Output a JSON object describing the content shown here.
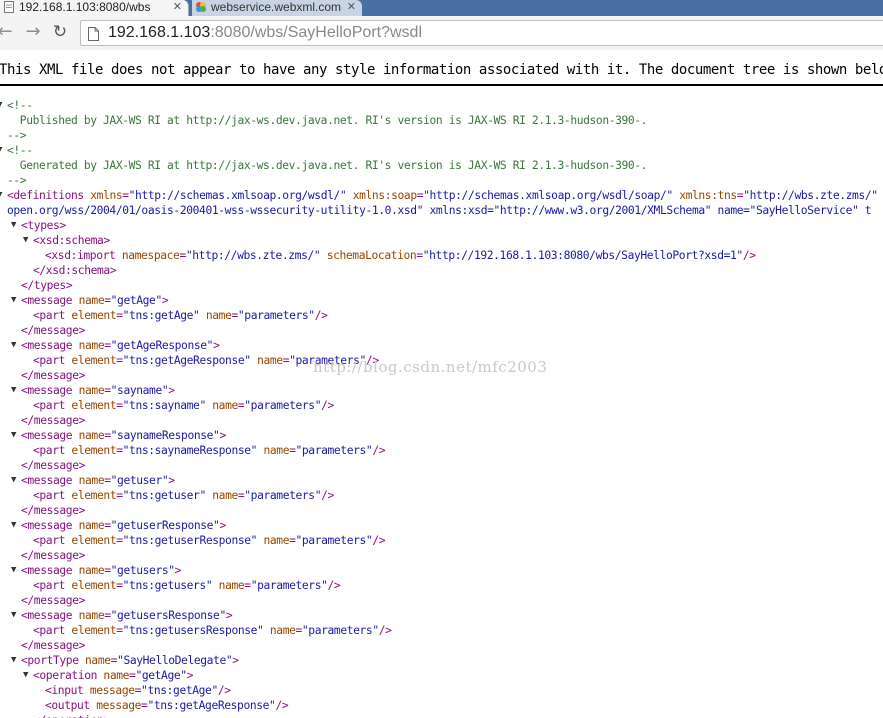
{
  "tabs": [
    {
      "title": "192.168.1.103:8080/wbs",
      "active": true,
      "icon": "page-icon"
    },
    {
      "title": "webservice.webxml.com",
      "active": false,
      "icon": "colorful-favicon"
    }
  ],
  "address": {
    "host": "192.168.1.103",
    "path": ":8080/wbs/SayHelloPort?wsdl"
  },
  "infobar_text": "This XML file does not appear to have any style information associated with it. The document tree is shown below.",
  "watermark": "http://blog.csdn.net/mfc2003",
  "xml_lines": [
    {
      "toggle": true,
      "text": "<!--",
      "cls": "c"
    },
    {
      "toggle": false,
      "text": "  Published by JAX-WS RI at http://jax-ws.dev.java.net. RI's version is JAX-WS RI 2.1.3-hudson-390-.",
      "cls": "c"
    },
    {
      "toggle": false,
      "text": "-->",
      "cls": "c"
    },
    {
      "toggle": true,
      "text": "<!--",
      "cls": "c"
    },
    {
      "toggle": false,
      "text": "  Generated by JAX-WS RI at http://jax-ws.dev.java.net. RI's version is JAX-WS RI 2.1.3-hudson-390-.",
      "cls": "c"
    },
    {
      "toggle": false,
      "text": "-->",
      "cls": "c"
    },
    {
      "toggle": true,
      "text": "<definitions xmlns=\"http://schemas.xmlsoap.org/wsdl/\" xmlns:soap=\"http://schemas.xmlsoap.org/wsdl/soap/\" xmlns:tns=\"http://wbs.zte.zms/\""
    },
    {
      "toggle": false,
      "text": "open.org/wss/2004/01/oasis-200401-wss-wssecurity-utility-1.0.xsd\" xmlns:xsd=\"http://www.w3.org/2001/XMLSchema\" name=\"SayHelloService\" t"
    },
    {
      "toggle": true,
      "text": "<types>"
    },
    {
      "toggle": true,
      "text": "<xsd:schema>"
    },
    {
      "toggle": false,
      "text": "<xsd:import namespace=\"http://wbs.zte.zms/\" schemaLocation=\"http://192.168.1.103:8080/wbs/SayHelloPort?xsd=1\"/>"
    },
    {
      "toggle": false,
      "text": "</xsd:schema>"
    },
    {
      "toggle": false,
      "text": "</types>"
    },
    {
      "toggle": true,
      "text": "<message name=\"getAge\">"
    },
    {
      "toggle": false,
      "text": "<part element=\"tns:getAge\" name=\"parameters\"/>"
    },
    {
      "toggle": false,
      "text": "</message>"
    },
    {
      "toggle": true,
      "text": "<message name=\"getAgeResponse\">"
    },
    {
      "toggle": false,
      "text": "<part element=\"tns:getAgeResponse\" name=\"parameters\"/>"
    },
    {
      "toggle": false,
      "text": "</message>"
    },
    {
      "toggle": true,
      "text": "<message name=\"sayname\">"
    },
    {
      "toggle": false,
      "text": "<part element=\"tns:sayname\" name=\"parameters\"/>"
    },
    {
      "toggle": false,
      "text": "</message>"
    },
    {
      "toggle": true,
      "text": "<message name=\"saynameResponse\">"
    },
    {
      "toggle": false,
      "text": "<part element=\"tns:saynameResponse\" name=\"parameters\"/>"
    },
    {
      "toggle": false,
      "text": "</message>"
    },
    {
      "toggle": true,
      "text": "<message name=\"getuser\">"
    },
    {
      "toggle": false,
      "text": "<part element=\"tns:getuser\" name=\"parameters\"/>"
    },
    {
      "toggle": false,
      "text": "</message>"
    },
    {
      "toggle": true,
      "text": "<message name=\"getuserResponse\">"
    },
    {
      "toggle": false,
      "text": "<part element=\"tns:getuserResponse\" name=\"parameters\"/>"
    },
    {
      "toggle": false,
      "text": "</message>"
    },
    {
      "toggle": true,
      "text": "<message name=\"getusers\">"
    },
    {
      "toggle": false,
      "text": "<part element=\"tns:getusers\" name=\"parameters\"/>"
    },
    {
      "toggle": false,
      "text": "</message>"
    },
    {
      "toggle": true,
      "text": "<message name=\"getusersResponse\">"
    },
    {
      "toggle": false,
      "text": "<part element=\"tns:getusersResponse\" name=\"parameters\"/>"
    },
    {
      "toggle": false,
      "text": "</message>"
    },
    {
      "toggle": true,
      "text": "<portType name=\"SayHelloDelegate\">"
    },
    {
      "toggle": true,
      "text": "<operation name=\"getAge\">"
    },
    {
      "toggle": false,
      "text": "<input message=\"tns:getAge\"/>"
    },
    {
      "toggle": false,
      "text": "<output message=\"tns:getAgeResponse\"/>"
    },
    {
      "toggle": false,
      "text": "</operation>"
    }
  ]
}
